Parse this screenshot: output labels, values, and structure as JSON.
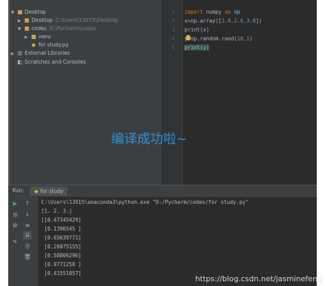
{
  "project_tree": {
    "root": {
      "label": "Desktop"
    },
    "desktop_item": {
      "label": "Desktop",
      "path": "C:\\Users\\13915\\Desktop"
    },
    "codes_item": {
      "label": "codes",
      "path": "D:\\Pycharm\\codes"
    },
    "venv_item": {
      "label": "venv"
    },
    "file_item": {
      "label": "for study.py"
    },
    "external_libraries": {
      "label": "External Libraries"
    },
    "scratches": {
      "label": "Scratches and Consoles"
    }
  },
  "editor": {
    "line_numbers": [
      "1",
      "2",
      "3",
      "4",
      "5"
    ],
    "lines": [
      {
        "kw": "import",
        "rest": " numpy ",
        "kw2": "as",
        "rest2": " np"
      },
      {
        "a": "x=np.array([",
        "n1": "1.0",
        "s1": ",",
        "n2": "2.0",
        "s2": ",",
        "n3": "3.0",
        "b": "])"
      },
      {
        "text": "print(x)"
      },
      {
        "a": "y=np.random.rand(",
        "n1": "10",
        "s1": ",",
        "n2": "1",
        "b": ")"
      },
      {
        "text": "print(y)"
      }
    ]
  },
  "caption": "编译成功啦~",
  "run": {
    "label": "Run:",
    "tab": "for study",
    "console_lines": [
      "C:\\Users\\13915\\anaconda3\\python.exe \"D:/Pycharm/codes/for study.py\"",
      "[1. 2. 3.]",
      "[[0.47345429]",
      " [0.1396545 ]",
      " [0.65639771]",
      " [0.26075155]",
      " [0.58806296]",
      " [0.9771258 ]",
      " [0.41551057]"
    ]
  },
  "watermark": "https://blog.csdn.net/jasminefeng",
  "colors": {
    "caption": "#2f8fd8",
    "keyword": "#cc7832",
    "number": "#6897bb",
    "run_icon": "#4caf50"
  }
}
